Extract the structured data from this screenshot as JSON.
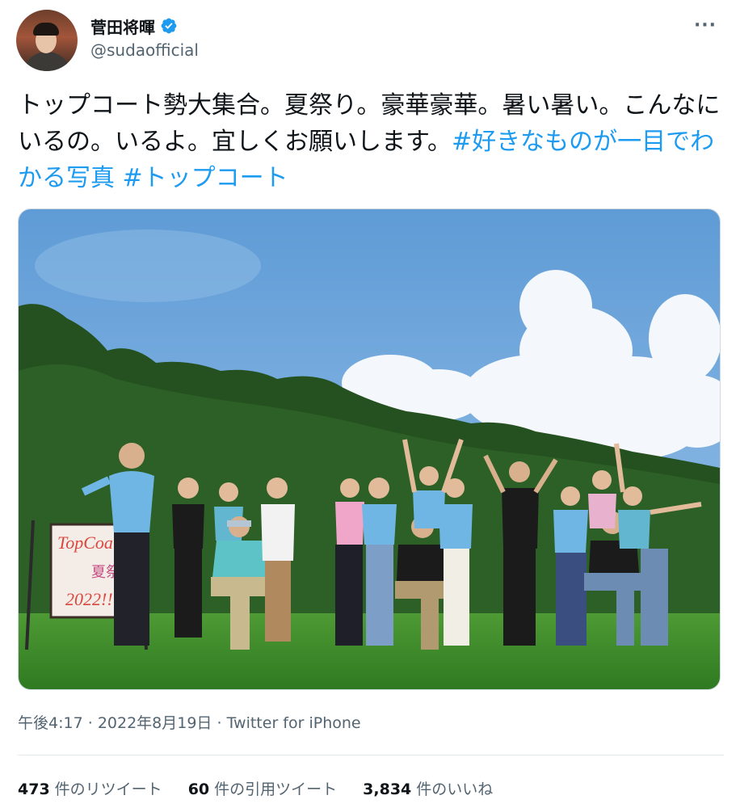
{
  "author": {
    "display_name": "菅田将暉",
    "handle": "@sudaofficial",
    "verified_icon": "verified-badge-icon",
    "avatar": "profile-photo"
  },
  "more_icon": "more-options-icon",
  "more_glyph": "···",
  "tweet": {
    "text_part": "トップコート勢大集合。夏祭り。豪華豪華。暑い暑い。こんなにいるの。いるよ。宜しくお願いします。",
    "hashtag_1": "#好きなものが一目でわかる写真",
    "hashtag_2": "#トップコート"
  },
  "media": {
    "alt": "group photo outdoors",
    "sign_text_1": "TopCoat",
    "sign_text_2": "夏祭り",
    "sign_text_3": "2022!!",
    "colors": {
      "sky": "#6fa7db",
      "grass": "#3f8a2a",
      "trees": "#1f4a22",
      "shirt_blue": "#5fb2de",
      "shirt_black": "#1b1b1b"
    }
  },
  "meta": {
    "time": "午後4:17",
    "date": "2022年8月19日",
    "separator": "·",
    "source": "Twitter for iPhone"
  },
  "stats": {
    "retweets_count": "473",
    "retweets_label": "件のリツイート",
    "quotes_count": "60",
    "quotes_label": "件の引用ツイート",
    "likes_count": "3,834",
    "likes_label": "件のいいね"
  },
  "accent_color": "#1d9bf0"
}
